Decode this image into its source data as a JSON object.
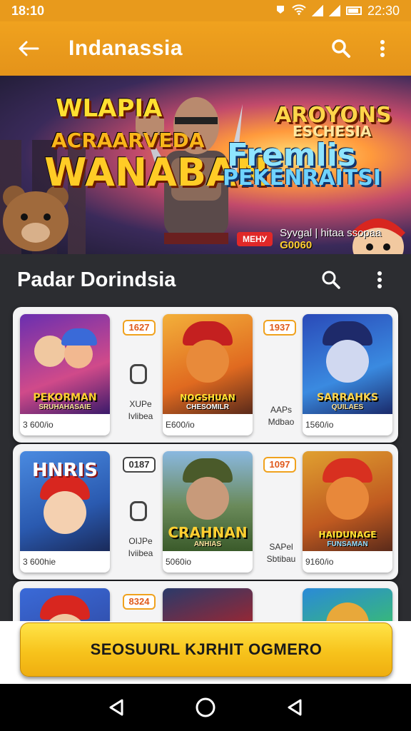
{
  "status_bar": {
    "time": "18:10",
    "clock": "22:30"
  },
  "app_bar": {
    "title": "Indanassia"
  },
  "banner": {
    "headline_1": "WLAPIA",
    "headline_2": "ACRAARVEDA",
    "headline_3": "WANABAN",
    "headline_4": "AROYONS",
    "headline_5": "ESCHESIA",
    "headline_6": "Fremlis",
    "headline_7": "PEKENRAITSI",
    "badge": "МЕНУ",
    "caption_prefix": "Syvgal | hitaa ssopaa",
    "caption_highlight": "G0060"
  },
  "section": {
    "title": "Padar Dorindsia"
  },
  "rows": [
    {
      "cards": [
        {
          "title": "PEKORMAN",
          "subtitle": "SRUHAHASAIE",
          "label": "3 600/io"
        },
        {
          "title": "NOGSHUAN",
          "subtitle": "CHESOMILR",
          "label": "E600/io"
        },
        {
          "title": "SARRAHKS",
          "subtitle": "QUILAES",
          "label": "1560/io"
        }
      ],
      "minis": [
        {
          "badge": "1627",
          "text_1": "XUPe",
          "text_2": "Ivlibea"
        },
        {
          "badge": "1937",
          "text_1": "AAPs",
          "text_2": "Mdbao"
        }
      ]
    },
    {
      "cards": [
        {
          "title": "HNRIS",
          "subtitle": "",
          "label": "3 600hie"
        },
        {
          "title": "CRAHNAN",
          "subtitle": "ANHIAS",
          "label": "5060io"
        },
        {
          "title": "HAIDUNAGE",
          "subtitle": "FUNSAMAN",
          "label": "9160/io"
        }
      ],
      "minis": [
        {
          "badge": "0187",
          "text_1": "OIJPe",
          "text_2": "Iviibea"
        },
        {
          "badge": "1097",
          "text_1": "SAPel",
          "text_2": "Sbtibau"
        }
      ]
    },
    {
      "cards": [
        {
          "title": "",
          "subtitle": "",
          "label": ""
        },
        {
          "title": "",
          "subtitle": "",
          "label": ""
        },
        {
          "title": "",
          "subtitle": "",
          "label": ""
        }
      ],
      "minis": [
        {
          "badge": "8324",
          "text_1": "",
          "text_2": ""
        },
        {
          "badge": "",
          "text_1": "",
          "text_2": ""
        }
      ]
    }
  ],
  "cta": {
    "label": "SEOSUURL KJRHIT OGMERO"
  },
  "colors": {
    "accent": "#f0a21e",
    "cta": "#f7c31c",
    "surface": "#f4f4f5",
    "background": "#2c2d31"
  },
  "icons": [
    "back-arrow-icon",
    "search-icon",
    "more-vert-icon",
    "nav-back-icon",
    "nav-home-icon",
    "nav-recents-icon"
  ]
}
